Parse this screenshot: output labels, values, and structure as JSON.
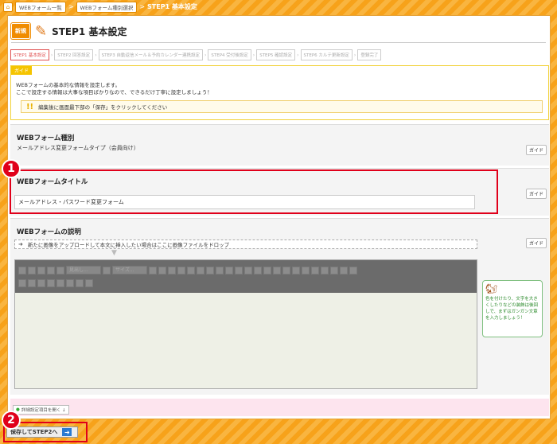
{
  "breadcrumb": {
    "home_icon": "home-icon",
    "items": [
      "WEBフォーム一覧",
      "WEBフォーム種別選択"
    ],
    "separator": ">",
    "current": "STEP1 基本設定"
  },
  "header": {
    "new_badge": "新規",
    "title": "STEP1 基本設定"
  },
  "steps": [
    {
      "label": "STEP1 基本設定",
      "active": true
    },
    {
      "label": "STEP2 回答設定",
      "active": false
    },
    {
      "label": "STEP3 自動返信メール＆予約カレンダー連携設定",
      "active": false
    },
    {
      "label": "STEP4 受付後設定",
      "active": false
    },
    {
      "label": "STEP5 確認設定",
      "active": false
    },
    {
      "label": "STEP6 カルテ更新設定",
      "active": false
    },
    {
      "label": "登録完了",
      "active": false
    }
  ],
  "guide": {
    "tag": "ガイド",
    "line1": "WEBフォームの基本的な情報を設定します。",
    "line2": "ここで設定する情報は大事な項目ばかりなので、できるだけ丁寧に設定しましょう！",
    "note": "編集後に画面最下部の「保存」をクリックしてください"
  },
  "sections": {
    "type": {
      "title": "WEBフォーム種別",
      "value": "メールアドレス変更フォームタイプ（会員向け）",
      "guide_label": "ガイド"
    },
    "form_title": {
      "title": "WEBフォームタイトル",
      "input_value": "メールアドレス・パスワード変更フォーム",
      "guide_label": "ガイド"
    },
    "description": {
      "title": "WEBフォームの説明",
      "guide_label": "ガイド",
      "dropzone_text": "新たに画像をアップロードして本文に挿入したい場合はここに画像ファイルをドロップ",
      "toolbar": {
        "heading_select": "見出し...",
        "size_select": "サイズ..."
      }
    }
  },
  "mascot": {
    "icon": "squirrel-icon",
    "text": "色を付けたり、文字を大きくしたりなどの装飾は後回しで、まずはガンガン文章を入力しましょう！"
  },
  "detail_toggle": "詳細設定項目を開く ↓",
  "save_button": "保存してSTEP2へ",
  "annotations": [
    "1",
    "2"
  ],
  "colors": {
    "accent_orange": "#f7a21a",
    "annotation_red": "#e0001a",
    "link_blue": "#2a7ad0"
  }
}
